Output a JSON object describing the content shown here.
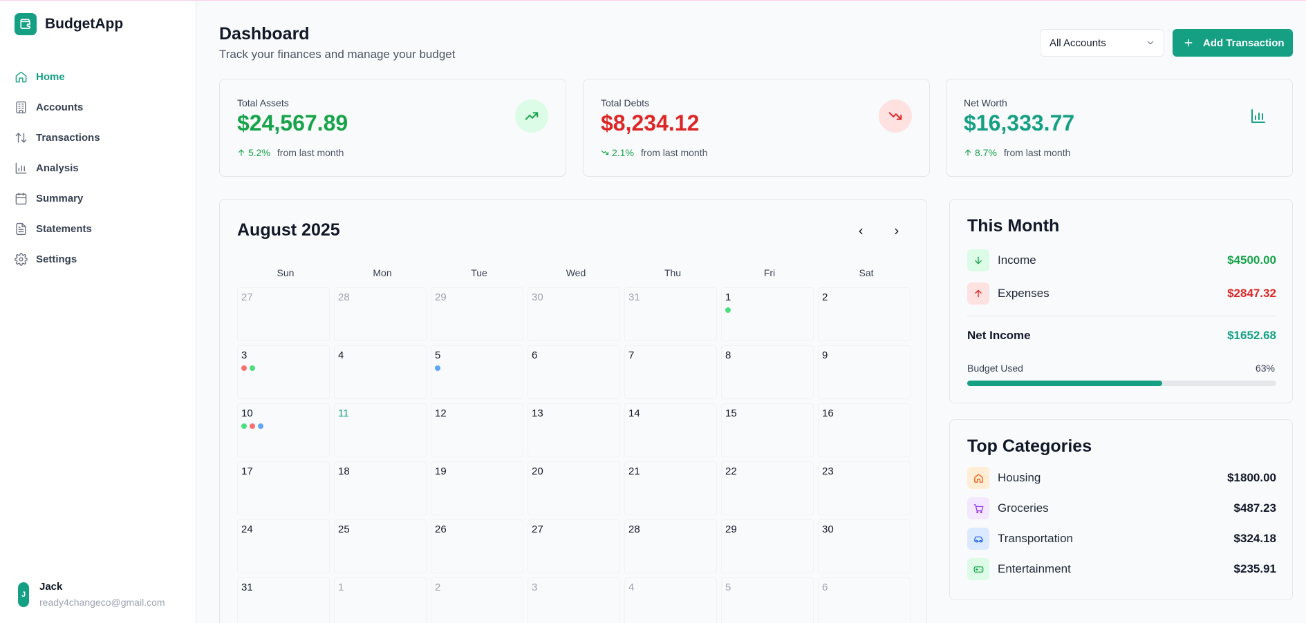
{
  "app": {
    "name": "BudgetApp"
  },
  "sidebar": {
    "items": [
      {
        "label": "Home",
        "icon": "home-icon",
        "active": true
      },
      {
        "label": "Accounts",
        "icon": "building-icon"
      },
      {
        "label": "Transactions",
        "icon": "arrows-up-down-icon"
      },
      {
        "label": "Analysis",
        "icon": "bar-chart-icon"
      },
      {
        "label": "Summary",
        "icon": "calendar-icon"
      },
      {
        "label": "Statements",
        "icon": "document-icon"
      },
      {
        "label": "Settings",
        "icon": "gear-icon"
      }
    ]
  },
  "user": {
    "initial": "J",
    "name": "Jack",
    "email": "ready4changeco@gmail.com"
  },
  "header": {
    "title": "Dashboard",
    "subtitle": "Track your finances and manage your budget",
    "account_select": "All Accounts",
    "add_button": "Add Transaction"
  },
  "stats": [
    {
      "label": "Total Assets",
      "value": "$24,567.89",
      "change": "5.2%",
      "from": "from last month",
      "color": "#16a34a",
      "icon": "trending-up-icon"
    },
    {
      "label": "Total Debts",
      "value": "$8,234.12",
      "change": "2.1%",
      "from": "from last month",
      "color": "#dc2626",
      "icon": "trending-down-icon"
    },
    {
      "label": "Net Worth",
      "value": "$16,333.77",
      "change": "8.7%",
      "from": "from last month",
      "color": "#159f83",
      "icon": "bar-chart-icon"
    }
  ],
  "calendar": {
    "title": "August 2025",
    "weekdays": [
      "Sun",
      "Mon",
      "Tue",
      "Wed",
      "Thu",
      "Fri",
      "Sat"
    ],
    "today": "11",
    "days": [
      {
        "n": "27",
        "other": true
      },
      {
        "n": "28",
        "other": true
      },
      {
        "n": "29",
        "other": true
      },
      {
        "n": "30",
        "other": true
      },
      {
        "n": "31",
        "other": true
      },
      {
        "n": "1",
        "dots": [
          "#4ade80"
        ]
      },
      {
        "n": "2"
      },
      {
        "n": "3",
        "dots": [
          "#f87171",
          "#4ade80"
        ]
      },
      {
        "n": "4"
      },
      {
        "n": "5",
        "dots": [
          "#60a5fa"
        ]
      },
      {
        "n": "6"
      },
      {
        "n": "7"
      },
      {
        "n": "8"
      },
      {
        "n": "9"
      },
      {
        "n": "10",
        "dots": [
          "#4ade80",
          "#f87171",
          "#60a5fa"
        ]
      },
      {
        "n": "11",
        "today": true
      },
      {
        "n": "12"
      },
      {
        "n": "13"
      },
      {
        "n": "14"
      },
      {
        "n": "15"
      },
      {
        "n": "16"
      },
      {
        "n": "17"
      },
      {
        "n": "18"
      },
      {
        "n": "19"
      },
      {
        "n": "20"
      },
      {
        "n": "21"
      },
      {
        "n": "22"
      },
      {
        "n": "23"
      },
      {
        "n": "24"
      },
      {
        "n": "25"
      },
      {
        "n": "26"
      },
      {
        "n": "27"
      },
      {
        "n": "28"
      },
      {
        "n": "29"
      },
      {
        "n": "30"
      },
      {
        "n": "31"
      },
      {
        "n": "1",
        "other": true
      },
      {
        "n": "2",
        "other": true
      },
      {
        "n": "3",
        "other": true
      },
      {
        "n": "4",
        "other": true
      },
      {
        "n": "5",
        "other": true
      },
      {
        "n": "6",
        "other": true
      }
    ]
  },
  "this_month": {
    "title": "This Month",
    "income_label": "Income",
    "income_value": "$4500.00",
    "expenses_label": "Expenses",
    "expenses_value": "$2847.32",
    "net_label": "Net Income",
    "net_value": "$1652.68",
    "budget_label": "Budget Used",
    "budget_pct": "63%",
    "budget_fraction": 0.63
  },
  "top_categories": {
    "title": "Top Categories",
    "items": [
      {
        "label": "Housing",
        "value": "$1800.00",
        "icon": "house-icon",
        "bg": "#ffedd5",
        "fg": "#ea580c"
      },
      {
        "label": "Groceries",
        "value": "$487.23",
        "icon": "cart-icon",
        "bg": "#f3e8ff",
        "fg": "#9333ea"
      },
      {
        "label": "Transportation",
        "value": "$324.18",
        "icon": "car-icon",
        "bg": "#dbeafe",
        "fg": "#2563eb"
      },
      {
        "label": "Entertainment",
        "value": "$235.91",
        "icon": "gamepad-icon",
        "bg": "#dcfce7",
        "fg": "#16a34a"
      }
    ]
  }
}
